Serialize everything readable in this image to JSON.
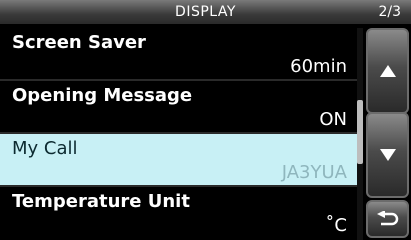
{
  "header": {
    "title": "DISPLAY",
    "page": "2/3"
  },
  "items": [
    {
      "label": "Screen Saver",
      "value": "60min"
    },
    {
      "label": "Opening Message",
      "value": "ON"
    },
    {
      "label": "My Call",
      "value": "JA3YUA"
    },
    {
      "label": "Temperature Unit",
      "value": "˚C"
    }
  ],
  "selected_item": "My Call",
  "scroll_buttons": [
    "up-arrow-icon",
    "down-arrow-icon",
    "return-icon"
  ]
}
